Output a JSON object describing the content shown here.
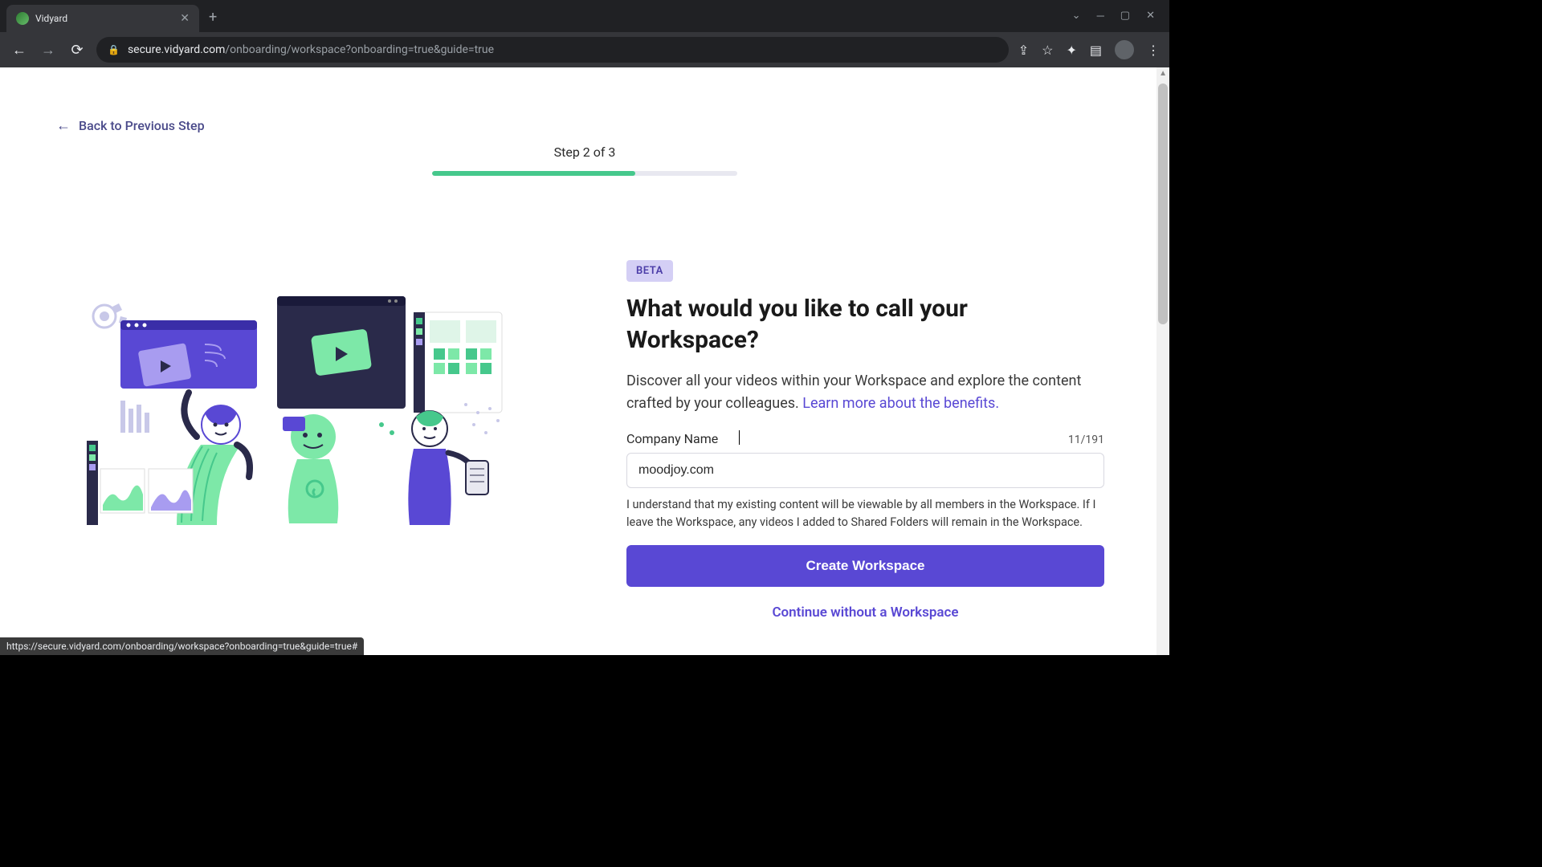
{
  "browser": {
    "tab_title": "Vidyard",
    "url_domain": "secure.vidyard.com",
    "url_path": "/onboarding/workspace?onboarding=true&guide=true",
    "status_url": "https://secure.vidyard.com/onboarding/workspace?onboarding=true&guide=true#"
  },
  "page": {
    "back_link": "Back to Previous Step",
    "step_label": "Step 2 of 3",
    "progress_percent": 66.6,
    "badge": "BETA",
    "heading": "What would you like to call your Workspace?",
    "description_text": "Discover all your videos within your Workspace and explore the content crafted by your colleagues. ",
    "description_link": "Learn more about the benefits.",
    "field_label": "Company Name",
    "char_count": "11/191",
    "input_value": "moodjoy.com",
    "disclaimer": "I understand that my existing content will be viewable by all members in the Workspace. If I leave the Workspace, any videos I added to Shared Folders will remain in the Workspace.",
    "primary_button": "Create Workspace",
    "secondary_link": "Continue without a Workspace"
  }
}
